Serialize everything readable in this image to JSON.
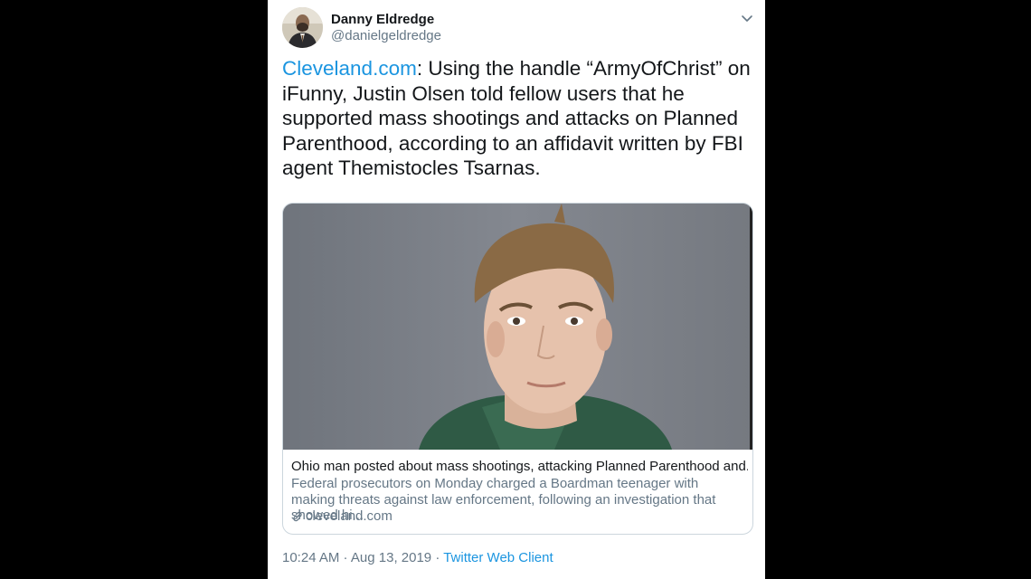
{
  "author": {
    "name": "Danny Eldredge",
    "handle": "@danielgeldredge"
  },
  "tweet": {
    "link_text": "Cleveland.com",
    "body": ": Using the handle “ArmyOfChrist” on iFunny, Justin Olsen told fellow users that he supported mass shootings and attacks on Planned Parenthood, according to an affidavit written by FBI agent Themistocles Tsarnas."
  },
  "card": {
    "title": "Ohio man posted about mass shootings, attacking Planned Parenthood and...",
    "description": "Federal prosecutors on Monday charged a Boardman teenager with making threats against law enforcement, following an investigation that showed hi...",
    "domain": "cleveland.com"
  },
  "meta": {
    "time": "10:24 AM",
    "separator1": " · ",
    "date": "Aug 13, 2019",
    "separator2": " · ",
    "client": "Twitter Web Client"
  },
  "icons": {
    "caret": "chevron-down-icon",
    "link": "link-icon"
  },
  "colors": {
    "link": "#1b95e0",
    "text": "#14171a",
    "secondary": "#657786",
    "border": "#ccd6dd"
  }
}
